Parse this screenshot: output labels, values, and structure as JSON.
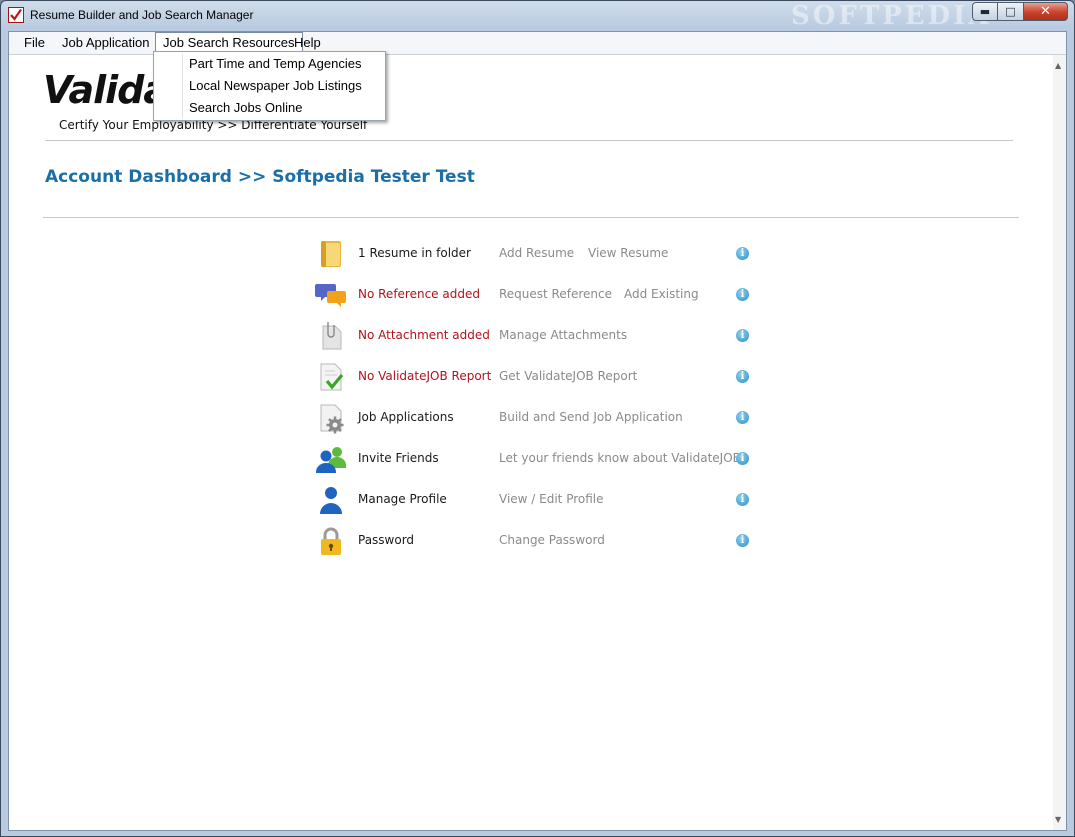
{
  "window": {
    "title": "Resume Builder and Job Search Manager",
    "watermark": "SOFTPEDIA"
  },
  "menubar": {
    "items": [
      "File",
      "Job Application",
      "Job Search Resources",
      "Help"
    ]
  },
  "dropdown": {
    "items": [
      "Part Time and Temp Agencies",
      "Local Newspaper Job Listings",
      "Search Jobs Online"
    ]
  },
  "header": {
    "logo": "Validate",
    "tagline": "Certify Your Employability >> Differentiate Yourself"
  },
  "dashboard": {
    "title": "Account Dashboard >> Softpedia Tester Test",
    "rows": [
      {
        "icon": "folder-icon",
        "label": "1 Resume in folder",
        "status": "ok",
        "action1": "Add Resume",
        "action2": "View Resume"
      },
      {
        "icon": "speech-bubbles-icon",
        "label": "No Reference added",
        "status": "missing",
        "action1": "Request Reference",
        "action2": "Add Existing"
      },
      {
        "icon": "paperclip-document-icon",
        "label": "No Attachment added",
        "status": "missing",
        "action1": "Manage Attachments",
        "action2": ""
      },
      {
        "icon": "checked-document-icon",
        "label": "No ValidateJOB Report",
        "status": "missing",
        "action1": "Get ValidateJOB Report",
        "action2": ""
      },
      {
        "icon": "gear-document-icon",
        "label": "Job Applications",
        "status": "ok",
        "action1": "Build and Send Job Application",
        "action2": ""
      },
      {
        "icon": "users-icon",
        "label": "Invite Friends",
        "status": "ok",
        "action1": "Let your friends know about ValidateJOB",
        "action2": ""
      },
      {
        "icon": "user-icon",
        "label": "Manage Profile",
        "status": "ok",
        "action1": "View / Edit Profile",
        "action2": ""
      },
      {
        "icon": "padlock-icon",
        "label": "Password",
        "status": "ok",
        "action1": "Change Password",
        "action2": ""
      }
    ],
    "info_glyph": "i"
  },
  "colors": {
    "accent": "#1a6fa8",
    "missing": "#b2121c",
    "action": "#8a8a8a"
  }
}
